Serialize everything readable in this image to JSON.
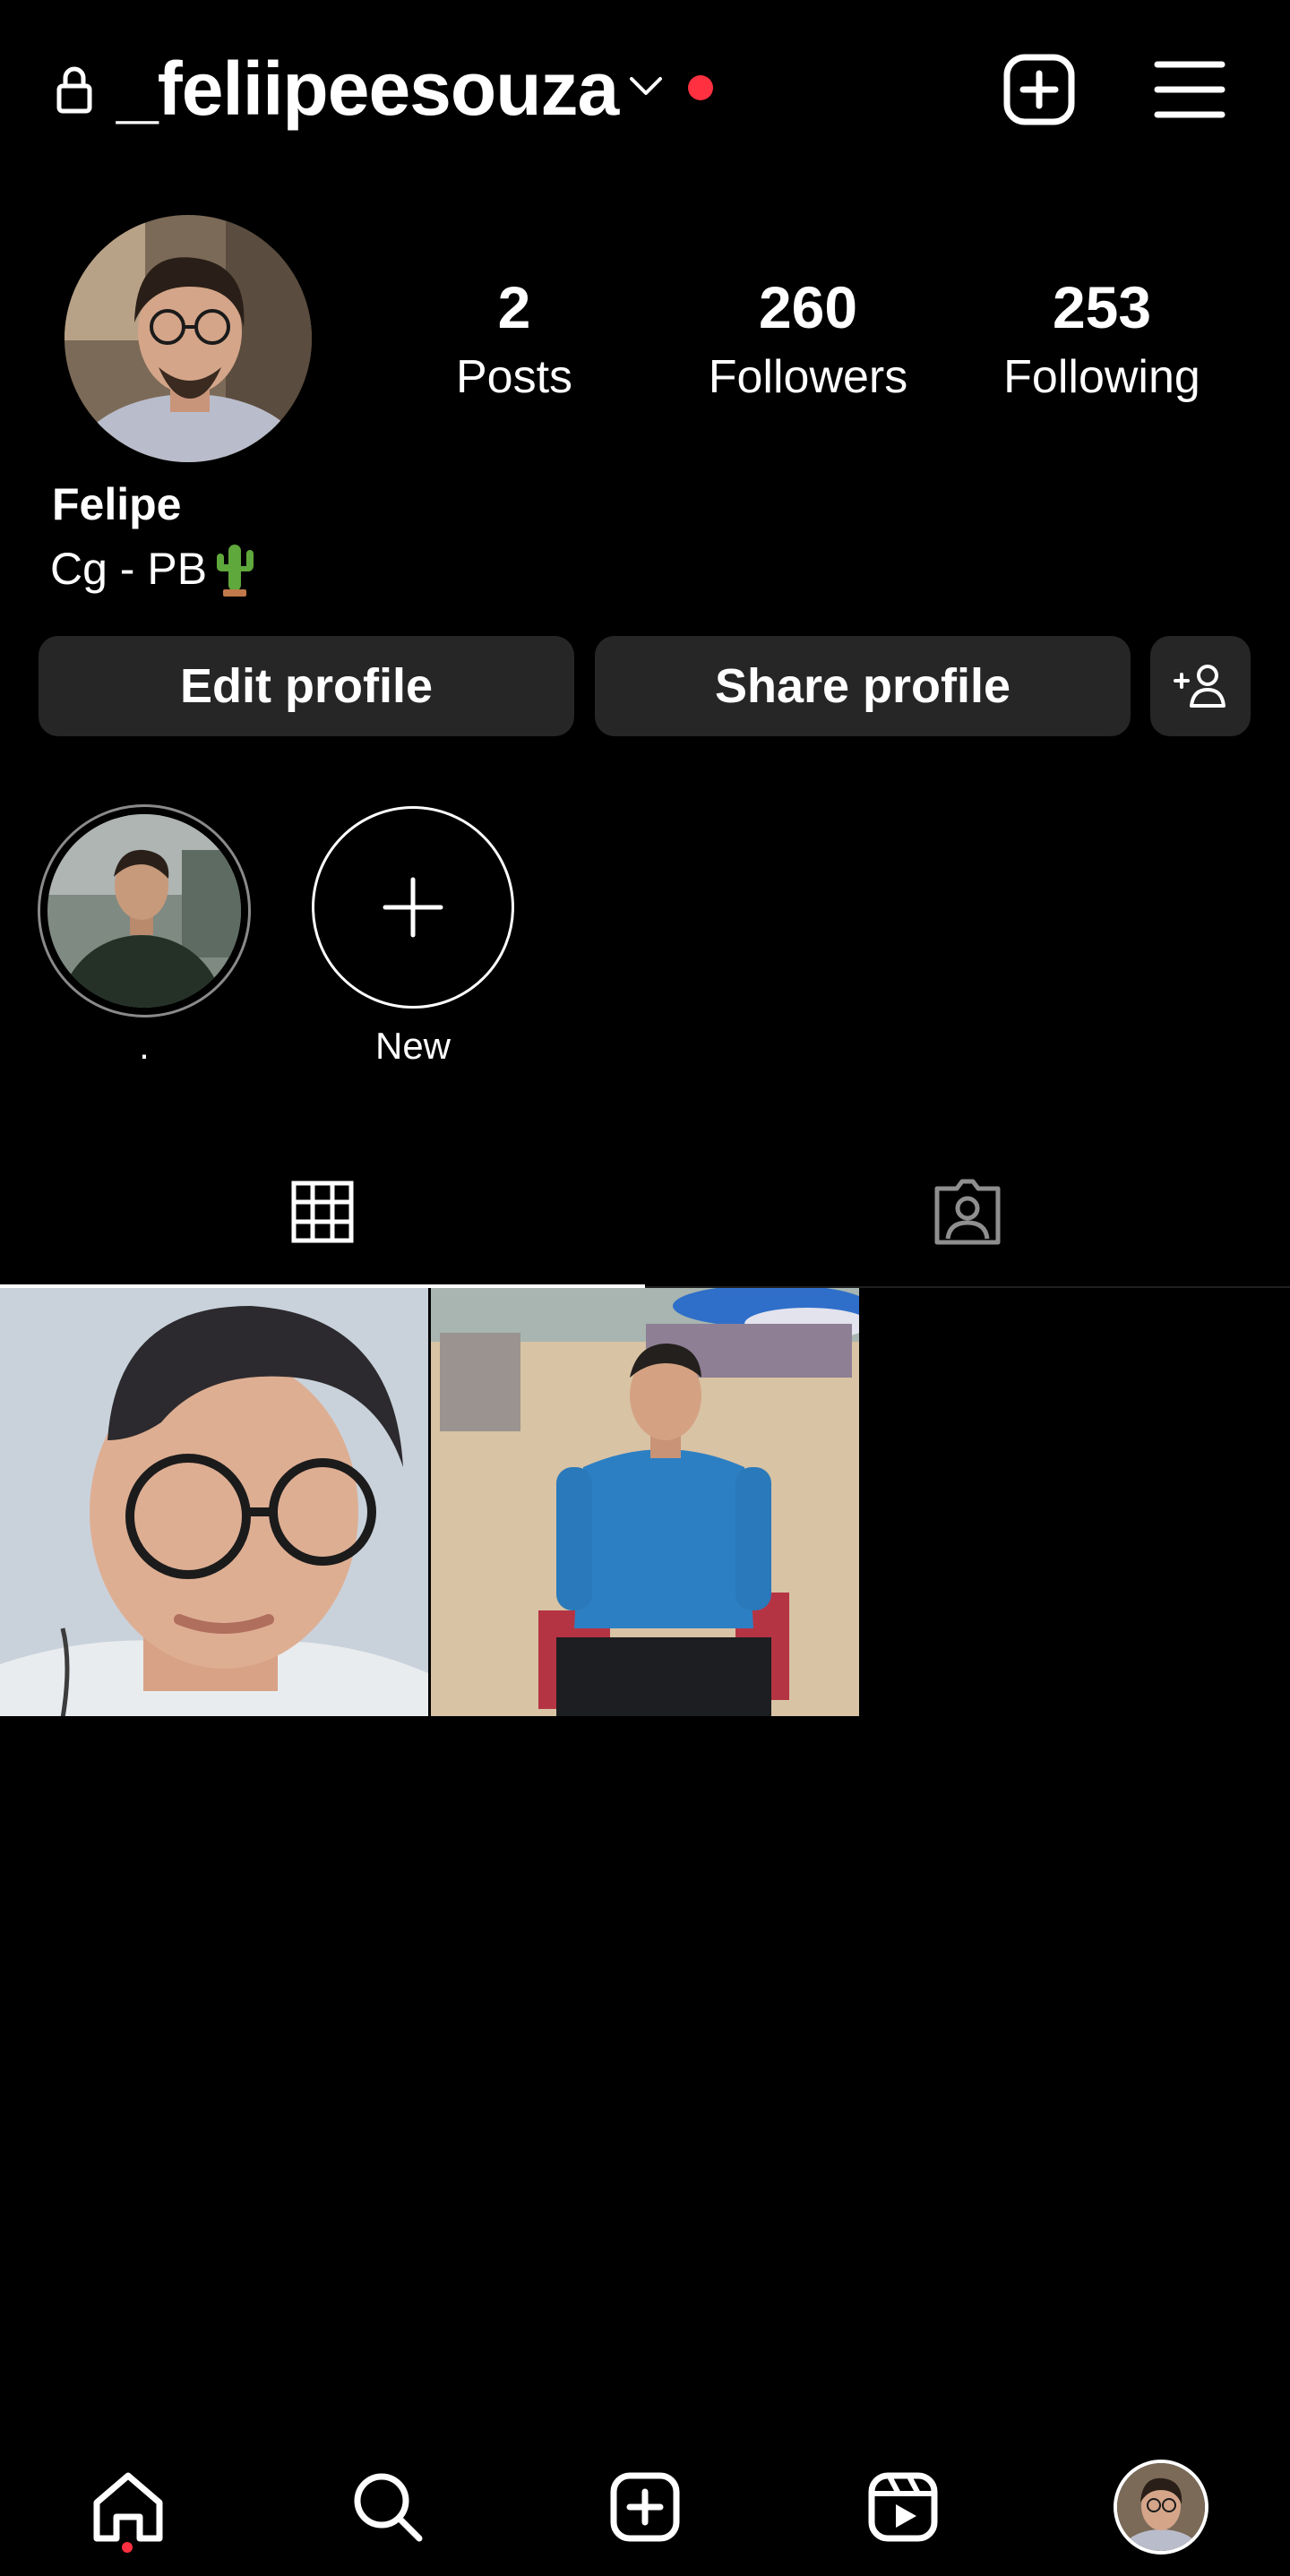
{
  "header": {
    "username": "_feliipeesouza",
    "notification_color": "#ff3040"
  },
  "profile": {
    "name": "Felipe",
    "bio": "Cg - PB",
    "bio_emoji": "cactus",
    "stats": {
      "posts": {
        "value": "2",
        "label": "Posts"
      },
      "followers": {
        "value": "260",
        "label": "Followers"
      },
      "following": {
        "value": "253",
        "label": "Following"
      }
    }
  },
  "actions": {
    "edit_label": "Edit profile",
    "share_label": "Share profile"
  },
  "highlights": [
    {
      "label": "."
    },
    {
      "label": "New"
    }
  ],
  "tabs": [
    {
      "icon": "grid-icon",
      "active": true
    },
    {
      "icon": "tagged-icon",
      "active": false
    }
  ],
  "bottom_nav": {
    "items": [
      "home-icon",
      "search-icon",
      "create-icon",
      "reels-icon",
      "profile-avatar"
    ],
    "dot_color": "#ff3040"
  },
  "colors": {
    "background": "#000000",
    "button_bg": "#262626",
    "text": "#ffffff"
  }
}
